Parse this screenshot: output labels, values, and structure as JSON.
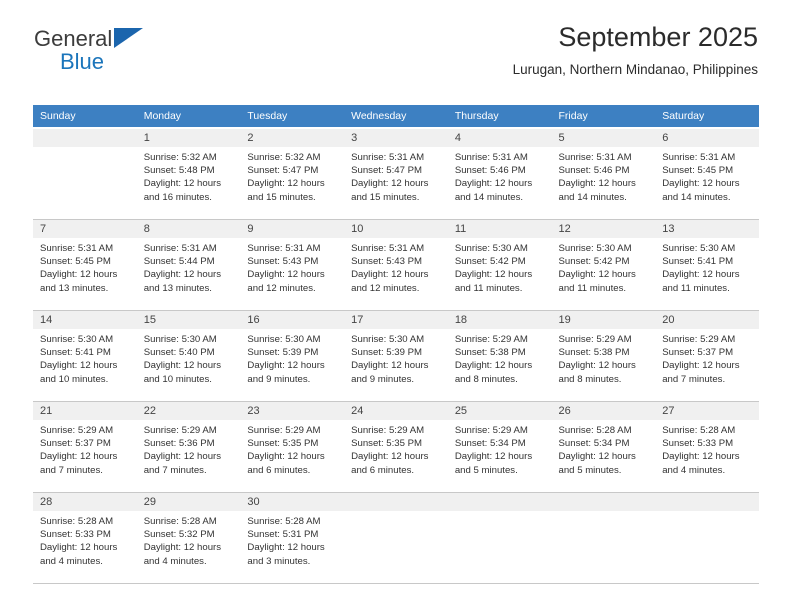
{
  "brand": {
    "name_part1": "General",
    "name_part2": "Blue",
    "triangle_color": "#1b65ad",
    "blue_color": "#1b75bb"
  },
  "header": {
    "title": "September 2025",
    "subtitle": "Lurugan, Northern Mindanao, Philippines"
  },
  "theme": {
    "header_row_bg": "#3d80c2",
    "daynum_bg": "#f0f0f0",
    "text": "#333333"
  },
  "weekdays": [
    "Sunday",
    "Monday",
    "Tuesday",
    "Wednesday",
    "Thursday",
    "Friday",
    "Saturday"
  ],
  "weeks": [
    [
      {
        "day": "",
        "sunrise": "",
        "sunset": "",
        "daylight1": "",
        "daylight2": ""
      },
      {
        "day": "1",
        "sunrise": "Sunrise: 5:32 AM",
        "sunset": "Sunset: 5:48 PM",
        "daylight1": "Daylight: 12 hours",
        "daylight2": "and 16 minutes."
      },
      {
        "day": "2",
        "sunrise": "Sunrise: 5:32 AM",
        "sunset": "Sunset: 5:47 PM",
        "daylight1": "Daylight: 12 hours",
        "daylight2": "and 15 minutes."
      },
      {
        "day": "3",
        "sunrise": "Sunrise: 5:31 AM",
        "sunset": "Sunset: 5:47 PM",
        "daylight1": "Daylight: 12 hours",
        "daylight2": "and 15 minutes."
      },
      {
        "day": "4",
        "sunrise": "Sunrise: 5:31 AM",
        "sunset": "Sunset: 5:46 PM",
        "daylight1": "Daylight: 12 hours",
        "daylight2": "and 14 minutes."
      },
      {
        "day": "5",
        "sunrise": "Sunrise: 5:31 AM",
        "sunset": "Sunset: 5:46 PM",
        "daylight1": "Daylight: 12 hours",
        "daylight2": "and 14 minutes."
      },
      {
        "day": "6",
        "sunrise": "Sunrise: 5:31 AM",
        "sunset": "Sunset: 5:45 PM",
        "daylight1": "Daylight: 12 hours",
        "daylight2": "and 14 minutes."
      }
    ],
    [
      {
        "day": "7",
        "sunrise": "Sunrise: 5:31 AM",
        "sunset": "Sunset: 5:45 PM",
        "daylight1": "Daylight: 12 hours",
        "daylight2": "and 13 minutes."
      },
      {
        "day": "8",
        "sunrise": "Sunrise: 5:31 AM",
        "sunset": "Sunset: 5:44 PM",
        "daylight1": "Daylight: 12 hours",
        "daylight2": "and 13 minutes."
      },
      {
        "day": "9",
        "sunrise": "Sunrise: 5:31 AM",
        "sunset": "Sunset: 5:43 PM",
        "daylight1": "Daylight: 12 hours",
        "daylight2": "and 12 minutes."
      },
      {
        "day": "10",
        "sunrise": "Sunrise: 5:31 AM",
        "sunset": "Sunset: 5:43 PM",
        "daylight1": "Daylight: 12 hours",
        "daylight2": "and 12 minutes."
      },
      {
        "day": "11",
        "sunrise": "Sunrise: 5:30 AM",
        "sunset": "Sunset: 5:42 PM",
        "daylight1": "Daylight: 12 hours",
        "daylight2": "and 11 minutes."
      },
      {
        "day": "12",
        "sunrise": "Sunrise: 5:30 AM",
        "sunset": "Sunset: 5:42 PM",
        "daylight1": "Daylight: 12 hours",
        "daylight2": "and 11 minutes."
      },
      {
        "day": "13",
        "sunrise": "Sunrise: 5:30 AM",
        "sunset": "Sunset: 5:41 PM",
        "daylight1": "Daylight: 12 hours",
        "daylight2": "and 11 minutes."
      }
    ],
    [
      {
        "day": "14",
        "sunrise": "Sunrise: 5:30 AM",
        "sunset": "Sunset: 5:41 PM",
        "daylight1": "Daylight: 12 hours",
        "daylight2": "and 10 minutes."
      },
      {
        "day": "15",
        "sunrise": "Sunrise: 5:30 AM",
        "sunset": "Sunset: 5:40 PM",
        "daylight1": "Daylight: 12 hours",
        "daylight2": "and 10 minutes."
      },
      {
        "day": "16",
        "sunrise": "Sunrise: 5:30 AM",
        "sunset": "Sunset: 5:39 PM",
        "daylight1": "Daylight: 12 hours",
        "daylight2": "and 9 minutes."
      },
      {
        "day": "17",
        "sunrise": "Sunrise: 5:30 AM",
        "sunset": "Sunset: 5:39 PM",
        "daylight1": "Daylight: 12 hours",
        "daylight2": "and 9 minutes."
      },
      {
        "day": "18",
        "sunrise": "Sunrise: 5:29 AM",
        "sunset": "Sunset: 5:38 PM",
        "daylight1": "Daylight: 12 hours",
        "daylight2": "and 8 minutes."
      },
      {
        "day": "19",
        "sunrise": "Sunrise: 5:29 AM",
        "sunset": "Sunset: 5:38 PM",
        "daylight1": "Daylight: 12 hours",
        "daylight2": "and 8 minutes."
      },
      {
        "day": "20",
        "sunrise": "Sunrise: 5:29 AM",
        "sunset": "Sunset: 5:37 PM",
        "daylight1": "Daylight: 12 hours",
        "daylight2": "and 7 minutes."
      }
    ],
    [
      {
        "day": "21",
        "sunrise": "Sunrise: 5:29 AM",
        "sunset": "Sunset: 5:37 PM",
        "daylight1": "Daylight: 12 hours",
        "daylight2": "and 7 minutes."
      },
      {
        "day": "22",
        "sunrise": "Sunrise: 5:29 AM",
        "sunset": "Sunset: 5:36 PM",
        "daylight1": "Daylight: 12 hours",
        "daylight2": "and 7 minutes."
      },
      {
        "day": "23",
        "sunrise": "Sunrise: 5:29 AM",
        "sunset": "Sunset: 5:35 PM",
        "daylight1": "Daylight: 12 hours",
        "daylight2": "and 6 minutes."
      },
      {
        "day": "24",
        "sunrise": "Sunrise: 5:29 AM",
        "sunset": "Sunset: 5:35 PM",
        "daylight1": "Daylight: 12 hours",
        "daylight2": "and 6 minutes."
      },
      {
        "day": "25",
        "sunrise": "Sunrise: 5:29 AM",
        "sunset": "Sunset: 5:34 PM",
        "daylight1": "Daylight: 12 hours",
        "daylight2": "and 5 minutes."
      },
      {
        "day": "26",
        "sunrise": "Sunrise: 5:28 AM",
        "sunset": "Sunset: 5:34 PM",
        "daylight1": "Daylight: 12 hours",
        "daylight2": "and 5 minutes."
      },
      {
        "day": "27",
        "sunrise": "Sunrise: 5:28 AM",
        "sunset": "Sunset: 5:33 PM",
        "daylight1": "Daylight: 12 hours",
        "daylight2": "and 4 minutes."
      }
    ],
    [
      {
        "day": "28",
        "sunrise": "Sunrise: 5:28 AM",
        "sunset": "Sunset: 5:33 PM",
        "daylight1": "Daylight: 12 hours",
        "daylight2": "and 4 minutes."
      },
      {
        "day": "29",
        "sunrise": "Sunrise: 5:28 AM",
        "sunset": "Sunset: 5:32 PM",
        "daylight1": "Daylight: 12 hours",
        "daylight2": "and 4 minutes."
      },
      {
        "day": "30",
        "sunrise": "Sunrise: 5:28 AM",
        "sunset": "Sunset: 5:31 PM",
        "daylight1": "Daylight: 12 hours",
        "daylight2": "and 3 minutes."
      },
      {
        "day": "",
        "sunrise": "",
        "sunset": "",
        "daylight1": "",
        "daylight2": ""
      },
      {
        "day": "",
        "sunrise": "",
        "sunset": "",
        "daylight1": "",
        "daylight2": ""
      },
      {
        "day": "",
        "sunrise": "",
        "sunset": "",
        "daylight1": "",
        "daylight2": ""
      },
      {
        "day": "",
        "sunrise": "",
        "sunset": "",
        "daylight1": "",
        "daylight2": ""
      }
    ]
  ]
}
